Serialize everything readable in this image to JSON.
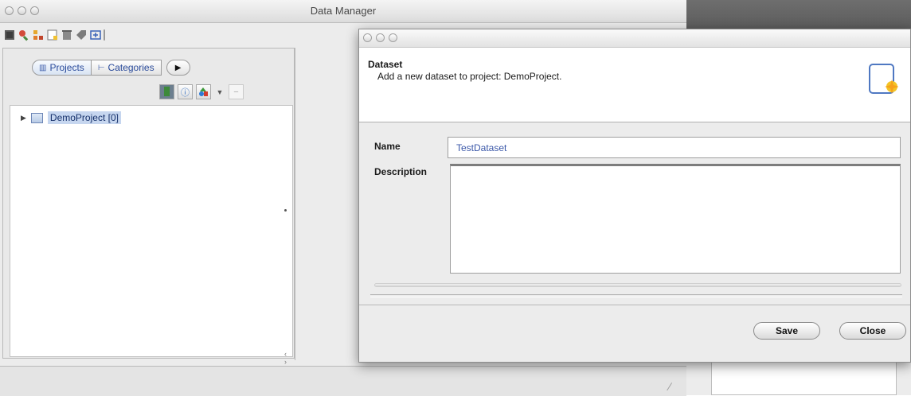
{
  "main_window": {
    "title": "Data Manager",
    "tabs": [
      {
        "label": "Projects",
        "icon": "project-tree-icon"
      },
      {
        "label": "Categories",
        "icon": "category-tree-icon"
      }
    ],
    "tree": [
      {
        "label": "DemoProject [0]",
        "expanded": false,
        "selected": true
      }
    ]
  },
  "dialog": {
    "header_title": "Dataset",
    "header_description": "Add a new dataset to project: DemoProject.",
    "name_label": "Name",
    "name_value": "TestDataset",
    "description_label": "Description",
    "description_value": "",
    "save_label": "Save",
    "close_label": "Close"
  },
  "colors": {
    "selection": "#c6d6ef",
    "link_text": "#2a4b9b",
    "input_text": "#3a57a8"
  }
}
